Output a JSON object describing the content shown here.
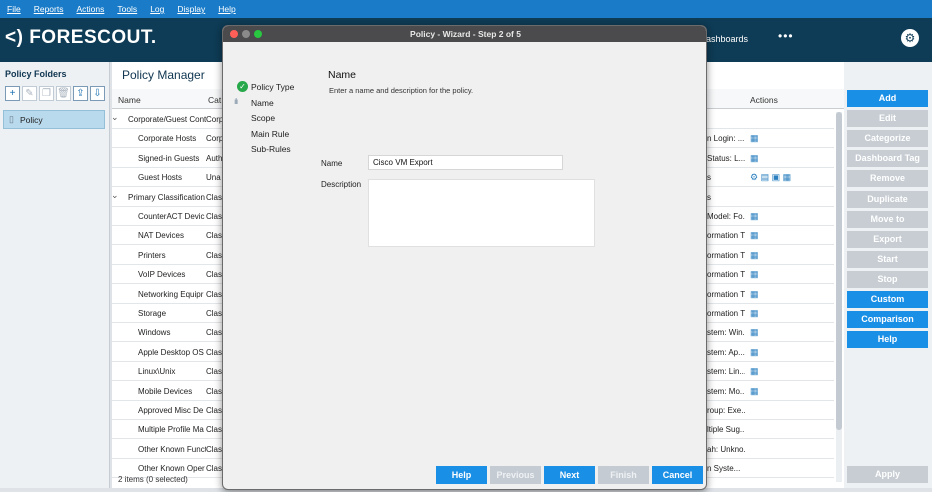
{
  "menu": [
    "File",
    "Reports",
    "Actions",
    "Tools",
    "Log",
    "Display",
    "Help"
  ],
  "header": {
    "logo": "<) FORESCOUT.",
    "dashboards": "ashboards",
    "more": "•••",
    "gear_icon": "gear-icon"
  },
  "folders": {
    "title": "Policy Folders",
    "item": "Policy"
  },
  "policy_manager": {
    "title": "Policy Manager",
    "col_name": "Name",
    "col_category": "Cat",
    "col_actions": "Actions",
    "rows": [
      {
        "name": "Corporate/Guest Cont",
        "cat": "Corp",
        "rule": "",
        "actions": "",
        "group": true
      },
      {
        "name": "Corporate Hosts",
        "cat": "Corp",
        "rule": "n Login: ...",
        "actions": "▦"
      },
      {
        "name": "Signed-in Guests",
        "cat": "Auth",
        "rule": "Status: L...",
        "actions": "▦"
      },
      {
        "name": "Guest Hosts",
        "cat": "Una",
        "rule": "s",
        "actions": "⚙ ▤ ▣ ▦"
      },
      {
        "name": "Primary Classification",
        "cat": "Clas",
        "rule": "s",
        "actions": "",
        "group": true
      },
      {
        "name": "CounterACT Devic",
        "cat": "Clas",
        "rule": "Model: Fo...",
        "actions": "▦"
      },
      {
        "name": "NAT Devices",
        "cat": "Clas",
        "rule": "ormation T...",
        "actions": "▦"
      },
      {
        "name": "Printers",
        "cat": "Clas",
        "rule": "ormation T...",
        "actions": "▦"
      },
      {
        "name": "VoIP Devices",
        "cat": "Clas",
        "rule": "ormation T...",
        "actions": "▦"
      },
      {
        "name": "Networking Equipr",
        "cat": "Clas",
        "rule": "ormation T...",
        "actions": "▦"
      },
      {
        "name": "Storage",
        "cat": "Clas",
        "rule": "ormation T...",
        "actions": "▦"
      },
      {
        "name": "Windows",
        "cat": "Clas",
        "rule": "stem: Win...",
        "actions": "▦"
      },
      {
        "name": "Apple Desktop OS",
        "cat": "Clas",
        "rule": "stem: Ap...",
        "actions": "▦"
      },
      {
        "name": "Linux\\Unix",
        "cat": "Clas",
        "rule": "stem: Lin...",
        "actions": "▦"
      },
      {
        "name": "Mobile Devices",
        "cat": "Clas",
        "rule": "stem: Mo...",
        "actions": "▦"
      },
      {
        "name": "Approved Misc De",
        "cat": "Clas",
        "rule": "roup: Exe...",
        "actions": ""
      },
      {
        "name": "Multiple Profile Ma",
        "cat": "Clas",
        "rule": "ltiple Sug...",
        "actions": ""
      },
      {
        "name": "Other Known Funct",
        "cat": "Clas",
        "rule": "ah: Unkno...",
        "actions": ""
      },
      {
        "name": "Other Known Oper",
        "cat": "Clas",
        "rule": "n Syste...",
        "actions": ""
      }
    ],
    "status": "2 items (0 selected)"
  },
  "right_buttons": [
    {
      "label": "Add",
      "enabled": true
    },
    {
      "label": "Edit",
      "enabled": false
    },
    {
      "label": "Categorize",
      "enabled": false
    },
    {
      "label": "Dashboard Tag",
      "enabled": false
    },
    {
      "label": "Remove",
      "enabled": false
    },
    {
      "label": "Duplicate",
      "enabled": false
    },
    {
      "label": "Move to",
      "enabled": false
    },
    {
      "label": "Export",
      "enabled": false
    },
    {
      "label": "Start",
      "enabled": false
    },
    {
      "label": "Stop",
      "enabled": false
    },
    {
      "label": "Custom",
      "enabled": true
    },
    {
      "label": "Comparison",
      "enabled": true
    },
    {
      "label": "Help",
      "enabled": true
    }
  ],
  "apply_label": "Apply",
  "dialog": {
    "title": "Policy - Wizard - Step 2 of 5",
    "steps": [
      "Policy Type",
      "Name",
      "Scope",
      "Main Rule",
      "Sub-Rules"
    ],
    "heading": "Name",
    "subheading": "Enter a name and description for the policy.",
    "name_label": "Name",
    "name_value": "Cisco VM Export",
    "description_label": "Description",
    "description_value": "",
    "buttons": {
      "help": "Help",
      "previous": "Previous",
      "next": "Next",
      "finish": "Finish",
      "cancel": "Cancel"
    }
  }
}
